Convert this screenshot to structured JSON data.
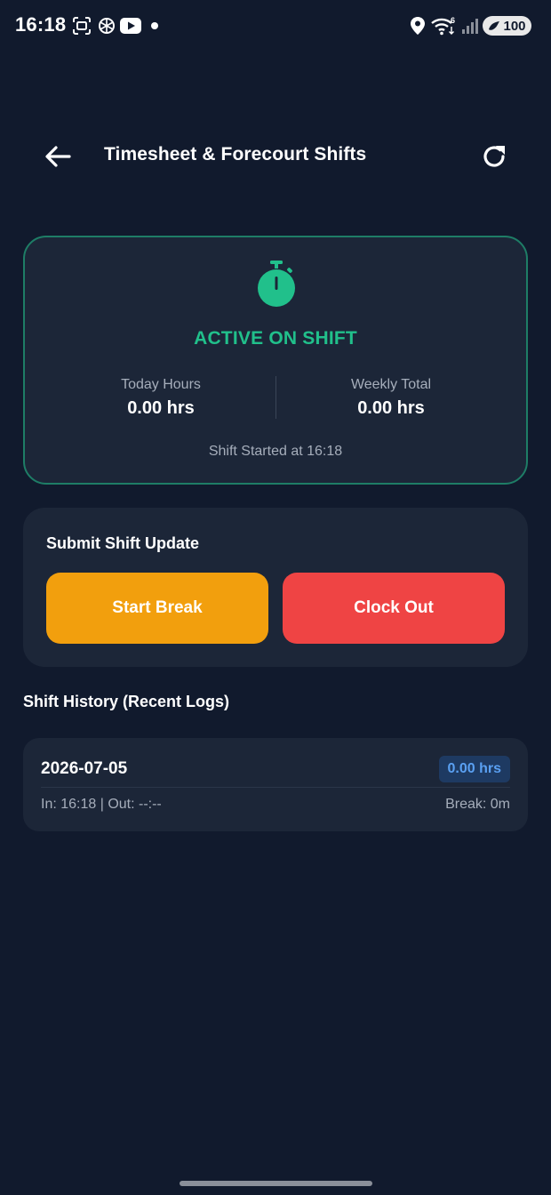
{
  "status_bar": {
    "time": "16:18",
    "battery": "100",
    "icons": [
      "screenshot-icon",
      "openai-icon",
      "youtube-icon",
      "notification-dot",
      "location-icon",
      "wifi-icon",
      "signal-icon",
      "battery-icon"
    ]
  },
  "header": {
    "title": "Timesheet & Forecourt Shifts",
    "back_icon": "arrow-left-icon",
    "refresh_icon": "refresh-icon"
  },
  "active_shift": {
    "icon": "stopwatch-icon",
    "status": "ACTIVE ON SHIFT",
    "today_label": "Today Hours",
    "today_value": "0.00 hrs",
    "weekly_label": "Weekly Total",
    "weekly_value": "0.00 hrs",
    "started_text": "Shift Started at 16:18"
  },
  "shift_update": {
    "title": "Submit Shift Update",
    "start_break_label": "Start Break",
    "clock_out_label": "Clock Out"
  },
  "history": {
    "title": "Shift History (Recent Logs)",
    "logs": [
      {
        "date": "2026-07-05",
        "hours": "0.00 hrs",
        "times": "In: 16:18 | Out: --:--",
        "break": "Break: 0m"
      }
    ]
  },
  "colors": {
    "background": "#111a2d",
    "card": "#1c2638",
    "accent_green": "#21c08b",
    "break_orange": "#f29f0d",
    "clockout_red": "#ef4444",
    "badge_blue": "#5aa0f2"
  }
}
